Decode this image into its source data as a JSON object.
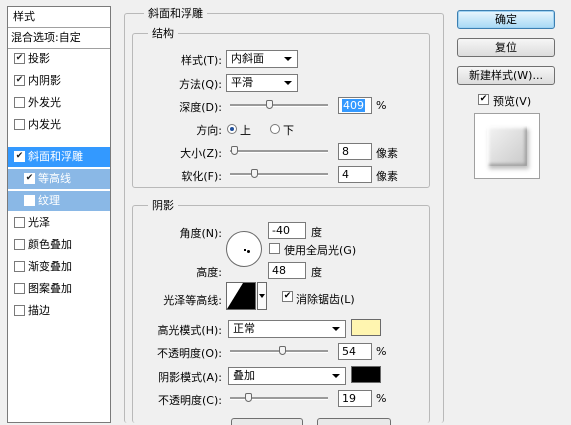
{
  "styles_panel": {
    "header": "样式",
    "items": [
      {
        "label": "混合选项:自定",
        "checkbox": false,
        "checked": false
      },
      {
        "label": "投影",
        "checkbox": true,
        "checked": true
      },
      {
        "label": "内阴影",
        "checkbox": true,
        "checked": true
      },
      {
        "label": "外发光",
        "checkbox": true,
        "checked": false
      },
      {
        "label": "内发光",
        "checkbox": true,
        "checked": false
      },
      {
        "label": "斜面和浮雕",
        "checkbox": true,
        "checked": true
      },
      {
        "label": "等高线",
        "checkbox": true,
        "checked": true
      },
      {
        "label": "纹理",
        "checkbox": true,
        "checked": false
      },
      {
        "label": "光泽",
        "checkbox": true,
        "checked": false
      },
      {
        "label": "颜色叠加",
        "checkbox": true,
        "checked": false
      },
      {
        "label": "渐变叠加",
        "checkbox": true,
        "checked": false
      },
      {
        "label": "图案叠加",
        "checkbox": true,
        "checked": false
      },
      {
        "label": "描边",
        "checkbox": true,
        "checked": false
      }
    ]
  },
  "bevel": {
    "title": "斜面和浮雕",
    "structure_title": "结构",
    "style_label": "样式(T):",
    "style_value": "内斜面",
    "technique_label": "方法(Q):",
    "technique_value": "平滑",
    "depth_label": "深度(D):",
    "depth_value": "409",
    "depth_slider": 0.41,
    "depth_unit": "%",
    "direction_label": "方向:",
    "direction_up": "上",
    "direction_down": "下",
    "size_label": "大小(Z):",
    "size_value": "8",
    "size_slider": 0.05,
    "size_unit": "像素",
    "soften_label": "软化(F):",
    "soften_value": "4",
    "soften_slider": 0.25,
    "soften_unit": "像素"
  },
  "shading": {
    "title": "阴影",
    "angle_label": "角度(N):",
    "angle_value": "-40",
    "angle_unit": "度",
    "global_light_label": "使用全局光(G)",
    "altitude_label": "高度:",
    "altitude_value": "48",
    "altitude_unit": "度",
    "gloss_label": "光泽等高线:",
    "antialias_label": "消除锯齿(L)",
    "highlight_mode_label": "高光模式(H):",
    "highlight_mode_value": "正常",
    "highlight_color": "#fff5b0",
    "highlight_opacity_label": "不透明度(O):",
    "highlight_opacity_value": "54",
    "highlight_opacity_slider": 0.54,
    "highlight_opacity_unit": "%",
    "shadow_mode_label": "阴影模式(A):",
    "shadow_mode_value": "叠加",
    "shadow_color": "#000000",
    "shadow_opacity_label": "不透明度(C):",
    "shadow_opacity_value": "19",
    "shadow_opacity_slider": 0.19,
    "shadow_opacity_unit": "%"
  },
  "buttons": {
    "ok": "确定",
    "reset": "复位",
    "new_style": "新建样式(W)...",
    "preview_label": "预览(V)"
  },
  "colors": {
    "selected": "#3399ff",
    "sub_selected": "#8ab8e6"
  }
}
